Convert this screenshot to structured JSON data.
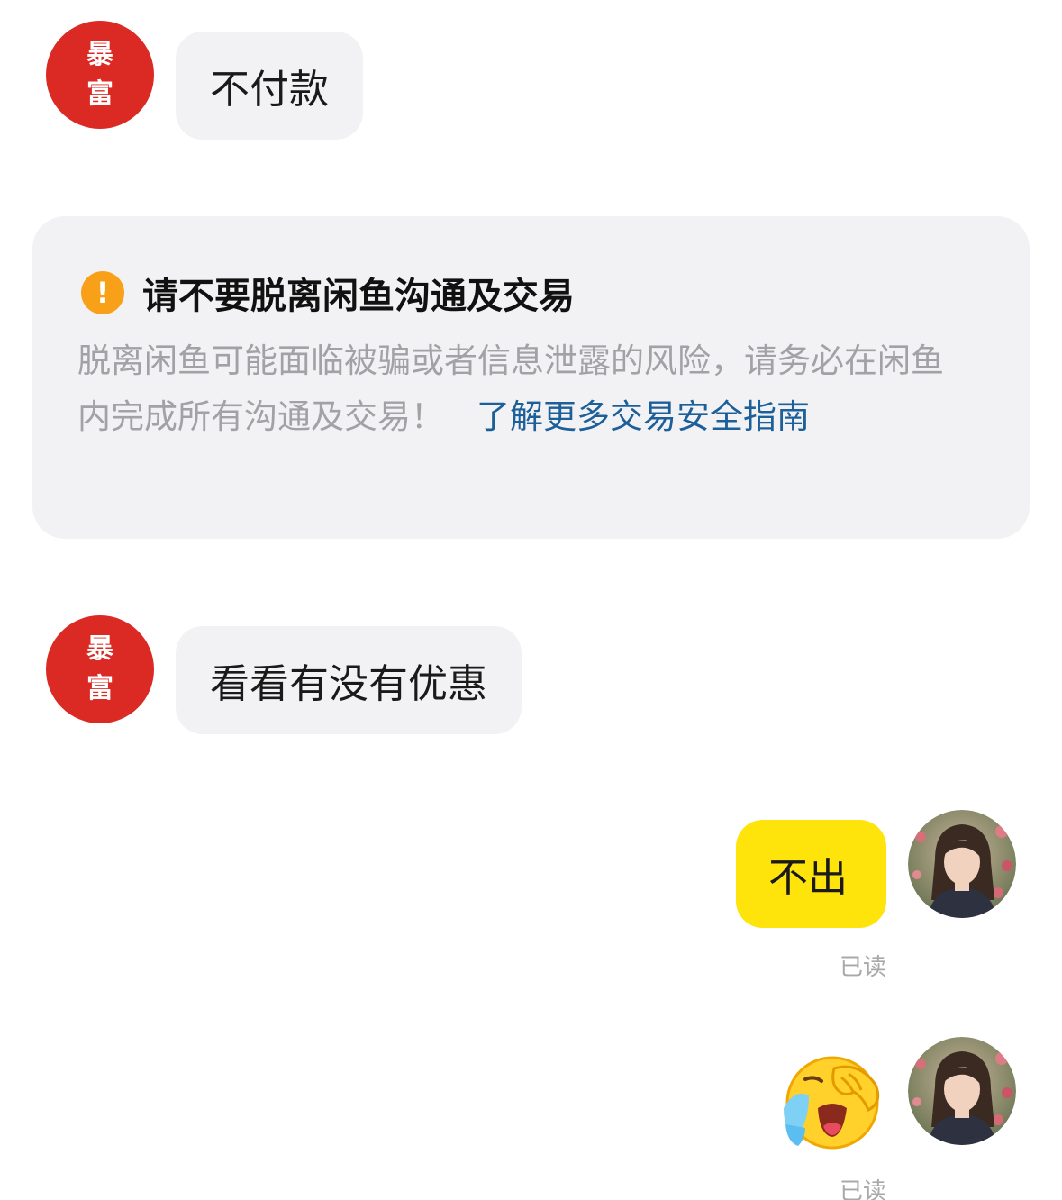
{
  "messages": {
    "m1": {
      "avatar_line1": "暴",
      "avatar_line2": "富",
      "text": "不付款"
    },
    "m2": {
      "avatar_line1": "暴",
      "avatar_line2": "富",
      "text": "看看有没有优惠"
    },
    "m3": {
      "text": "不出",
      "status": "已读"
    },
    "m4": {
      "emoji": "crying-face-emoji",
      "status": "已读"
    }
  },
  "notice": {
    "icon": "!",
    "title": "请不要脱离闲鱼沟通及交易",
    "body": "脱离闲鱼可能面临被骗或者信息泄露的风险，请务必在闲鱼内完成所有沟通及交易！",
    "link": "了解更多交易安全指南"
  },
  "colors": {
    "seller_avatar": "#db2a24",
    "incoming_bubble": "#f2f2f4",
    "outgoing_bubble": "#ffe40c",
    "warning": "#f9a019",
    "link": "#1d5f99"
  }
}
